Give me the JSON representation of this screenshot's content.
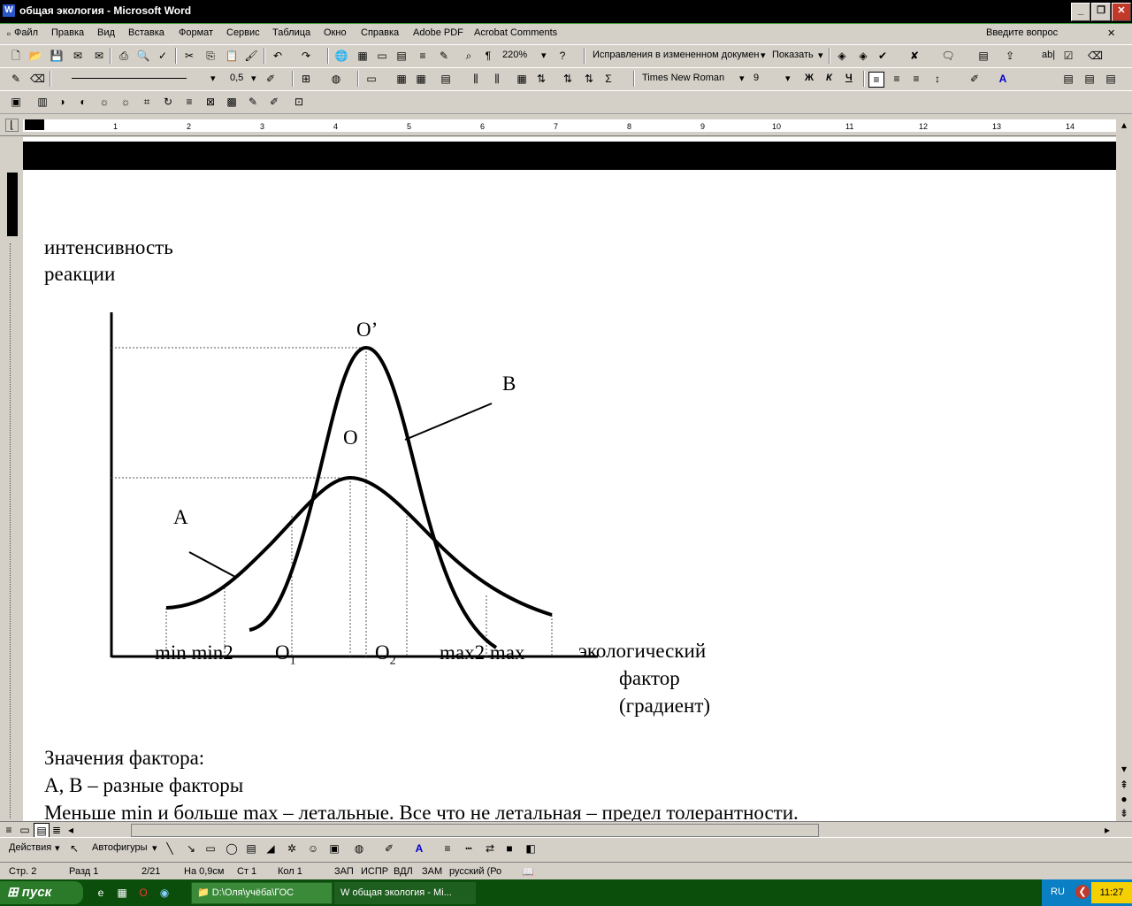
{
  "window": {
    "title": "общая экология - Microsoft Word"
  },
  "menu": {
    "items": [
      "Файл",
      "Правка",
      "Вид",
      "Вставка",
      "Формат",
      "Сервис",
      "Таблица",
      "Окно",
      "Справка",
      "Adobe PDF",
      "Acrobat Comments"
    ],
    "ask_placeholder": "Введите вопрос"
  },
  "toolbar": {
    "zoom": "220%",
    "track_changes": "Исправления в измененном докумен",
    "show": "Показать",
    "line_weight": "0,5",
    "font_name": "Times New Roman",
    "font_size": "9",
    "bold": "Ж",
    "italic": "К",
    "underline": "Ч",
    "sigma": "Σ"
  },
  "ruler": {
    "ticks": [
      "1",
      "2",
      "3",
      "4",
      "5",
      "6",
      "7",
      "8",
      "9",
      "10",
      "11",
      "12",
      "13",
      "14"
    ]
  },
  "document": {
    "y_label_line1": "интенсивность",
    "y_label_line2": "реакции",
    "peak_b": "O’",
    "peak_a": "O",
    "curve_b": "B",
    "curve_a": "A",
    "x_axis_labels": "min min2",
    "o1_base": "O",
    "o1_sub": "1",
    "o2_base": "O",
    "o2_sub": "2",
    "x_right_labels": "max2 max",
    "x_label_line1": "экологический",
    "x_label_line2": "фактор",
    "x_label_line3": "(градиент)",
    "para1": "Значения фактора:",
    "para2": "A, B – разные факторы",
    "para3": "Меньше min и больше max – летальные. Все что не летальная – предел толерантности."
  },
  "drawbar": {
    "actions": "Действия",
    "autoshapes": "Автофигуры"
  },
  "status": {
    "page": "Стр. 2",
    "section": "Разд 1",
    "pages": "2/21",
    "at": "На 0,9см",
    "line": "Ст 1",
    "col": "Кол 1",
    "rec": "ЗАП",
    "trk": "ИСПР",
    "ext": "ВДЛ",
    "ovr": "ЗАМ",
    "lang": "русский (Ро"
  },
  "taskbar": {
    "start": "пуск",
    "folder_task": "D:\\Оля\\учёба\\ГОС",
    "word_task": "общая экология - Mi...",
    "lang": "RU",
    "time": "11:27"
  }
}
